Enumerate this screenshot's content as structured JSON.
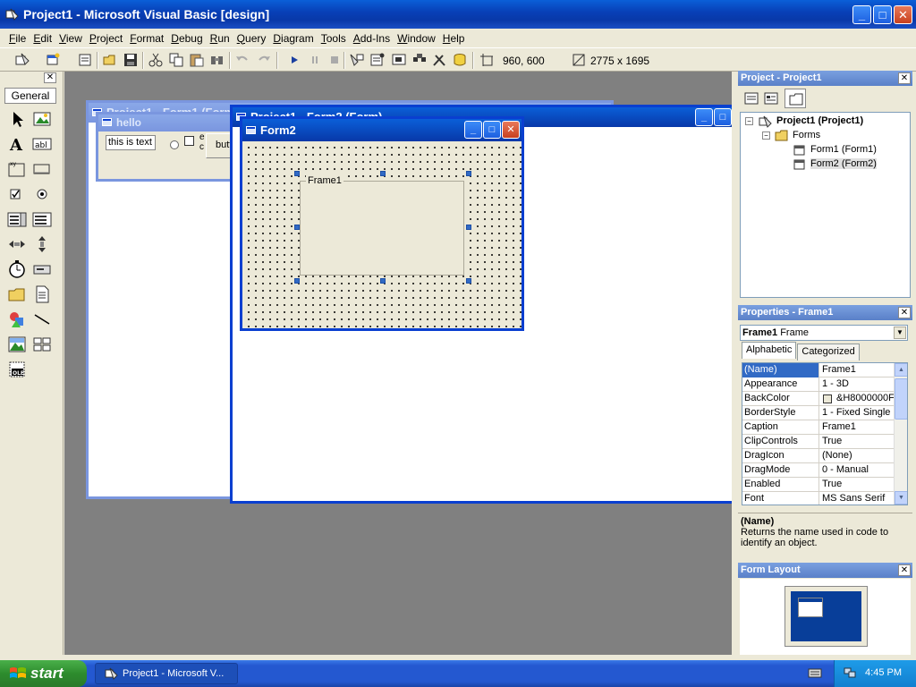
{
  "window": {
    "title": "Project1 - Microsoft Visual Basic [design]"
  },
  "menu": [
    "File",
    "Edit",
    "View",
    "Project",
    "Format",
    "Debug",
    "Run",
    "Query",
    "Diagram",
    "Tools",
    "Add-Ins",
    "Window",
    "Help"
  ],
  "toolbar": {
    "position": "960, 600",
    "size": "2775 x 1695"
  },
  "toolbox": {
    "tab_label": "General"
  },
  "windows": {
    "form1_title": "Project1 - Form1 (Form)",
    "hello_title": "hello",
    "hello_textbox": "this is text",
    "hello_button_partial": "butt",
    "hello_check_partial_1": "e",
    "hello_check_partial_2": "c",
    "form2_title": "Project1 - Form2 (Form)",
    "form2_caption": "Form2",
    "frame_caption": "Frame1"
  },
  "project_panel": {
    "title": "Project - Project1",
    "tree": [
      {
        "label": "Project1 (Project1)"
      },
      {
        "label": "Forms"
      },
      {
        "label": "Form1 (Form1)"
      },
      {
        "label": "Form2 (Form2)"
      }
    ]
  },
  "properties_panel": {
    "title": "Properties - Frame1",
    "object_name": "Frame1",
    "object_type": "Frame",
    "tabs": [
      "Alphabetic",
      "Categorized"
    ],
    "rows": [
      {
        "name": "(Name)",
        "value": "Frame1"
      },
      {
        "name": "Appearance",
        "value": "1 - 3D"
      },
      {
        "name": "BackColor",
        "value": "&H8000000F"
      },
      {
        "name": "BorderStyle",
        "value": "1 - Fixed Single"
      },
      {
        "name": "Caption",
        "value": "Frame1"
      },
      {
        "name": "ClipControls",
        "value": "True"
      },
      {
        "name": "DragIcon",
        "value": "(None)"
      },
      {
        "name": "DragMode",
        "value": "0 - Manual"
      },
      {
        "name": "Enabled",
        "value": "True"
      },
      {
        "name": "Font",
        "value": "MS Sans Serif"
      }
    ],
    "description_title": "(Name)",
    "description_text": "Returns the name used in code to identify an object."
  },
  "form_layout_panel": {
    "title": "Form Layout"
  },
  "taskbar": {
    "start_label": "start",
    "task_label": "Project1 - Microsoft V...",
    "clock": "4:45 PM"
  },
  "colors": {
    "xp_blue": "#0a3fd0",
    "selection": "#316ac5",
    "start_green": "#2d8c2d"
  }
}
